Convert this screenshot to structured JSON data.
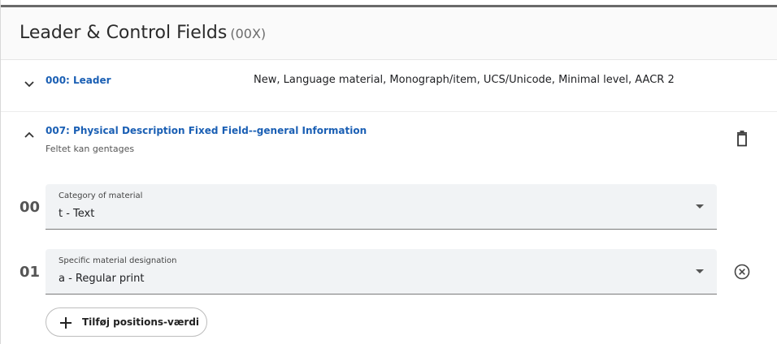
{
  "section": {
    "title": "Leader & Control Fields",
    "code": "(00X)"
  },
  "leader": {
    "tag_label": "000: Leader",
    "value": "New, Language material, Monograph/item, UCS/Unicode, Minimal level, AACR 2",
    "icon": "chevron-down-icon"
  },
  "field007": {
    "tag_label": "007: Physical Description Fixed Field--general Information",
    "subtitle": "Feltet kan gentages",
    "icon": "chevron-up-icon",
    "delete_icon": "trash-icon",
    "positions": [
      {
        "number": "00",
        "label": "Category of material",
        "value": "t - Text"
      },
      {
        "number": "01",
        "label": "Specific material designation",
        "value": "a - Regular print",
        "remove_icon": "circle-x-icon"
      }
    ],
    "add_button_label": "Tilføj positions-værdi"
  },
  "colors": {
    "link": "#1a5fb4",
    "field_bg": "#f1f3f5",
    "top_bar": "#6a6a6a"
  }
}
